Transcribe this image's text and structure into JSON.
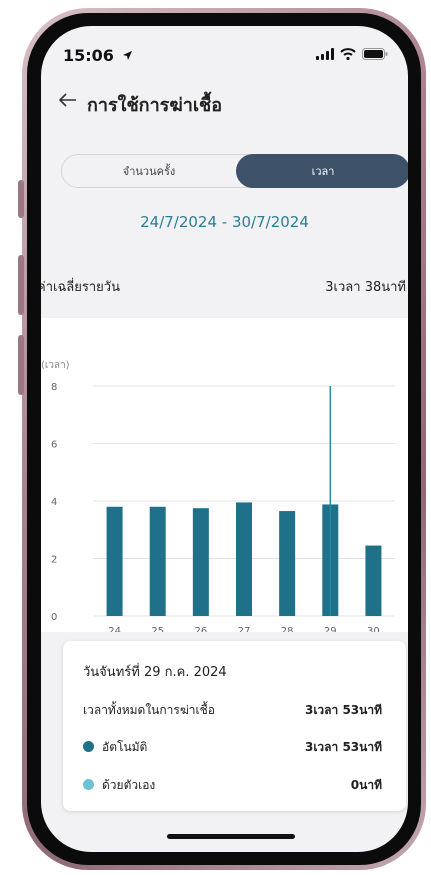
{
  "status_bar": {
    "time": "15:06"
  },
  "header": {
    "back_icon": "arrow-left-icon",
    "title": "การใช้การฆ่าเชื้อ"
  },
  "segment": {
    "left_label": "จำนวนครั้ง",
    "right_label": "เวลา",
    "selected": "เวลา"
  },
  "date_range": "24/7/2024 - 30/7/2024",
  "daily_average": {
    "label": "ค่าเฉลี่ยรายวัน",
    "value": "3เวลา 38นาที"
  },
  "colors": {
    "bar": "#1f7189",
    "selected_segment": "#3d5168",
    "accent_text": "#2b7e96",
    "manual_dot": "#6fc1d6"
  },
  "chart_data": {
    "type": "bar",
    "ylabel": "(เวลา)",
    "ylim": [
      0,
      8
    ],
    "yticks": [
      0,
      2,
      4,
      6,
      8
    ],
    "categories": [
      "24",
      "25",
      "26",
      "27",
      "28",
      "29",
      "30"
    ],
    "values": [
      3.8,
      3.8,
      3.75,
      3.95,
      3.65,
      3.88,
      2.45
    ],
    "highlight_category": "29",
    "grid": true
  },
  "tooltip": {
    "date": "วันจันทร์ที่ 29 ก.ค. 2024",
    "total_label": "เวลาทั้งหมดในการฆ่าเชื้อ",
    "total_value": "3เวลา 53นาที",
    "rows": [
      {
        "label": "อัตโนมัติ",
        "value": "3เวลา 53นาที",
        "color": "#1f7189"
      },
      {
        "label": "ด้วยตัวเอง",
        "value": "0นาที",
        "color": "#6fc1d6"
      }
    ]
  }
}
